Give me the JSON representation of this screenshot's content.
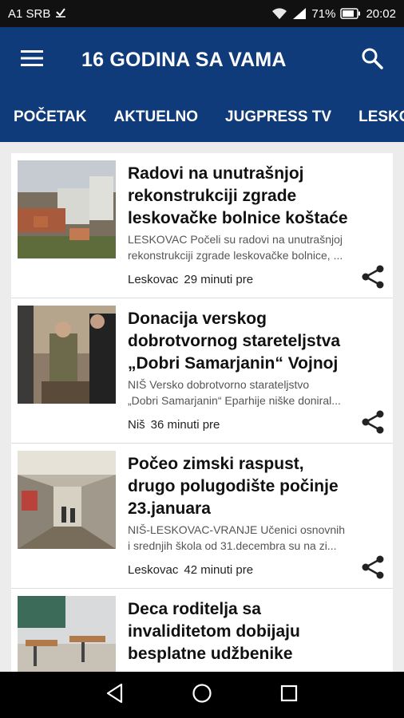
{
  "status_bar": {
    "carrier": "A1 SRB",
    "battery": "71%",
    "time": "20:02"
  },
  "app_bar": {
    "title": "16 GODINA SA VAMA"
  },
  "tabs": [
    {
      "label": "POČETAK"
    },
    {
      "label": "AKTUELNO"
    },
    {
      "label": "JUGPRESS TV"
    },
    {
      "label": "LESKOVAC"
    }
  ],
  "articles": [
    {
      "title_lines": [
        "Radovi na unutrašnjoj",
        "rekonstrukciji zgrade",
        "leskovačke bolnice koštaće"
      ],
      "excerpt_lines": [
        "LESKOVAC Počeli su radovi na unutrašnjoj",
        "rekonstrukciji zgrade leskovačke bolnice, ..."
      ],
      "location": "Leskovac",
      "time": "29 minuti pre"
    },
    {
      "title_lines": [
        "Donacija verskog",
        "dobrotvornog stareteljstva",
        "„Dobri Samarjanin“ Vojnoj"
      ],
      "excerpt_lines": [
        "NIŠ Versko dobrotvorno starateljstvo",
        "„Dobri Samarjanin“ Eparhije niške doniral..."
      ],
      "location": "Niš",
      "time": "36 minuti pre"
    },
    {
      "title_lines": [
        "Počeo zimski raspust,",
        "drugo polugodište počinje",
        "23.januara"
      ],
      "excerpt_lines": [
        "NIŠ-LESKOVAC-VRANJE  Učenici osnovnih",
        "i srednjih škola od 31.decembra su na zi..."
      ],
      "location": "Leskovac",
      "time": "42 minuti pre"
    },
    {
      "title_lines": [
        "Deca roditelja sa",
        "invaliditetom dobijaju",
        "besplatne udžbenike"
      ],
      "excerpt_lines": [
        "",
        ""
      ],
      "location": "",
      "time": ""
    }
  ],
  "icons": {
    "menu": "hamburger-menu-icon",
    "search": "search-icon",
    "share": "share-icon",
    "back": "back-triangle-icon",
    "home": "home-circle-icon",
    "recents": "recents-square-icon"
  },
  "colors": {
    "primary": "#0f3b7a",
    "background": "#ececec",
    "card": "#ffffff"
  }
}
